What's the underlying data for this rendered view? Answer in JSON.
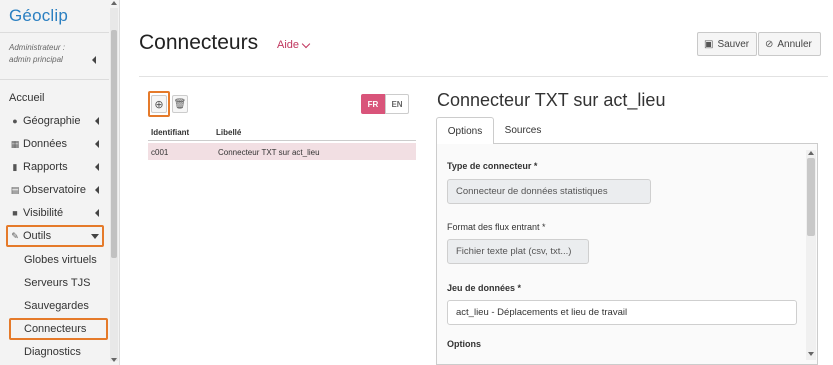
{
  "app": {
    "logo": "Géoclip"
  },
  "sidebar": {
    "admin_line1": "Administrateur :",
    "admin_line2": "admin principal",
    "home": "Accueil",
    "items": [
      {
        "label": "Géographie",
        "icon": "globe-icon"
      },
      {
        "label": "Données",
        "icon": "grid-icon"
      },
      {
        "label": "Rapports",
        "icon": "bar-chart-icon"
      },
      {
        "label": "Observatoire",
        "icon": "list-icon"
      },
      {
        "label": "Visibilité",
        "icon": "lock-icon"
      },
      {
        "label": "Outils",
        "icon": "wrench-icon"
      }
    ],
    "subitems": [
      "Globes virtuels",
      "Serveurs TJS",
      "Sauvegardes",
      "Connecteurs",
      "Diagnostics"
    ]
  },
  "header": {
    "title": "Connecteurs",
    "aide": "Aide",
    "save": "Sauver",
    "cancel": "Annuler"
  },
  "list": {
    "lang_fr": "FR",
    "lang_en": "EN",
    "col_id": "Identifiant",
    "col_label": "Libellé",
    "rows": [
      {
        "id": "c001",
        "label": "Connecteur TXT sur act_lieu"
      }
    ]
  },
  "detail": {
    "title": "Connecteur TXT sur act_lieu",
    "tabs": [
      "Options",
      "Sources"
    ],
    "type_label": "Type de connecteur *",
    "type_value": "Connecteur de données statistiques",
    "format_label": "Format des flux entrant *",
    "format_value": "Fichier texte plat (csv, txt...)",
    "dataset_label": "Jeu de données *",
    "dataset_value": "act_lieu - Déplacements et lieu de travail",
    "options_label": "Options"
  },
  "colors": {
    "accent": "#d9547a",
    "highlight": "#e57a2a",
    "logo": "#2a7fc1"
  }
}
